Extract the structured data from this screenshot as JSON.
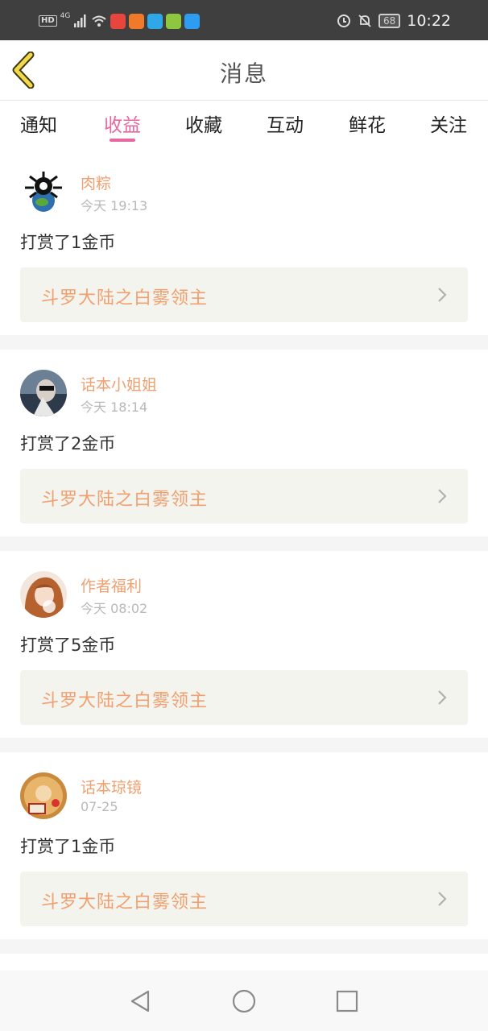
{
  "status_bar": {
    "hd": "HD",
    "network": "4G",
    "battery": "68",
    "time": "10:22",
    "app_colors": [
      "#e8453c",
      "#f07a2a",
      "#2fa8e8",
      "#8dc63f",
      "#2e9cf0"
    ]
  },
  "header": {
    "title": "消息"
  },
  "tabs": [
    {
      "label": "通知"
    },
    {
      "label": "收益",
      "active": true
    },
    {
      "label": "收藏"
    },
    {
      "label": "互动"
    },
    {
      "label": "鲜花"
    },
    {
      "label": "关注"
    }
  ],
  "accent_color": "#e8679e",
  "name_color": "#f0a070",
  "messages": [
    {
      "name": "肉粽",
      "time": "今天 19:13",
      "text": "打赏了1金币",
      "book": "斗罗大陆之白雾领主"
    },
    {
      "name": "话本小姐姐",
      "time": "今天 18:14",
      "text": "打赏了2金币",
      "book": "斗罗大陆之白雾领主"
    },
    {
      "name": "作者福利",
      "time": "今天 08:02",
      "text": "打赏了5金币",
      "book": "斗罗大陆之白雾领主"
    },
    {
      "name": "话本琼镜",
      "time": "07-25",
      "text": "打赏了1金币",
      "book": "斗罗大陆之白雾领主"
    }
  ]
}
